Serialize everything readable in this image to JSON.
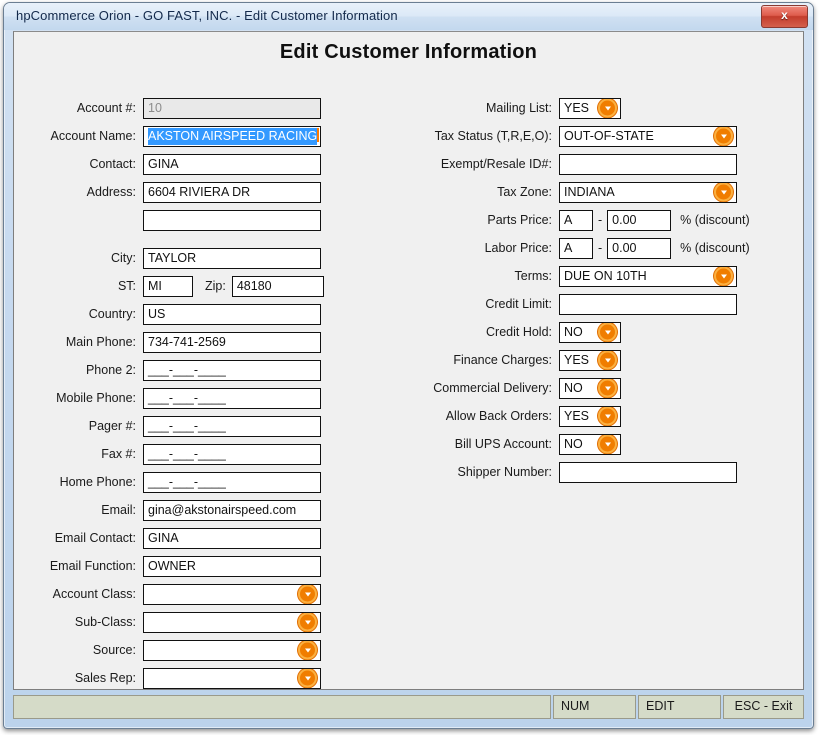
{
  "window": {
    "title": "hpCommerce Orion - GO FAST, INC. - Edit Customer Information",
    "close_label": "x"
  },
  "form": {
    "heading": "Edit Customer Information",
    "left": {
      "account_number": {
        "label": "Account #:",
        "value": "10"
      },
      "account_name": {
        "label": "Account Name:",
        "value": "AKSTON AIRSPEED RACING"
      },
      "contact": {
        "label": "Contact:",
        "value": "GINA"
      },
      "address1": {
        "label": "Address:",
        "value": "6604 RIVIERA DR"
      },
      "address2": {
        "label": "",
        "value": ""
      },
      "city": {
        "label": "City:",
        "value": "TAYLOR"
      },
      "state": {
        "label": "ST:",
        "value": "MI"
      },
      "zip": {
        "label": "Zip:",
        "value": "48180"
      },
      "country": {
        "label": "Country:",
        "value": "US"
      },
      "main_phone": {
        "label": "Main Phone:",
        "value": "734-741-2569"
      },
      "phone2": {
        "label": "Phone 2:",
        "value": "___-___-____"
      },
      "mobile_phone": {
        "label": "Mobile Phone:",
        "value": "___-___-____"
      },
      "pager": {
        "label": "Pager #:",
        "value": "___-___-____"
      },
      "fax": {
        "label": "Fax #:",
        "value": "___-___-____"
      },
      "home_phone": {
        "label": "Home Phone:",
        "value": "___-___-____"
      },
      "email": {
        "label": "Email:",
        "value": "gina@akstonairspeed.com"
      },
      "email_contact": {
        "label": "Email Contact:",
        "value": "GINA"
      },
      "email_function": {
        "label": "Email Function:",
        "value": "OWNER"
      },
      "account_class": {
        "label": "Account Class:",
        "value": ""
      },
      "sub_class": {
        "label": "Sub-Class:",
        "value": ""
      },
      "source": {
        "label": "Source:",
        "value": ""
      },
      "sales_rep": {
        "label": "Sales Rep:",
        "value": ""
      }
    },
    "right": {
      "mailing_list": {
        "label": "Mailing List:",
        "value": "YES"
      },
      "tax_status": {
        "label": "Tax Status (T,R,E,O):",
        "value": "OUT-OF-STATE"
      },
      "exempt_resale_id": {
        "label": "Exempt/Resale ID#:",
        "value": ""
      },
      "tax_zone": {
        "label": "Tax Zone:",
        "value": "INDIANA"
      },
      "parts_price": {
        "label": "Parts Price:",
        "code": "A",
        "separator": "-",
        "percent": "0.00",
        "suffix": "% (discount)"
      },
      "labor_price": {
        "label": "Labor Price:",
        "code": "A",
        "separator": "-",
        "percent": "0.00",
        "suffix": "% (discount)"
      },
      "terms": {
        "label": "Terms:",
        "value": "DUE ON 10TH"
      },
      "credit_limit": {
        "label": "Credit Limit:",
        "value": ""
      },
      "credit_hold": {
        "label": "Credit Hold:",
        "value": "NO"
      },
      "finance_charges": {
        "label": "Finance Charges:",
        "value": "YES"
      },
      "commercial_delivery": {
        "label": "Commercial Delivery:",
        "value": "NO"
      },
      "allow_back_orders": {
        "label": "Allow Back Orders:",
        "value": "YES"
      },
      "bill_ups_account": {
        "label": "Bill UPS Account:",
        "value": "NO"
      },
      "shipper_number": {
        "label": "Shipper Number:",
        "value": ""
      }
    }
  },
  "statusbar": {
    "main": "",
    "num": "NUM",
    "mode": "EDIT",
    "exit": "ESC - Exit"
  },
  "colors": {
    "accent_orange": "#f07d00",
    "selection_blue": "#3399ff",
    "status_bg": "#d5dbc8",
    "form_bg": "#f0f0f0"
  }
}
